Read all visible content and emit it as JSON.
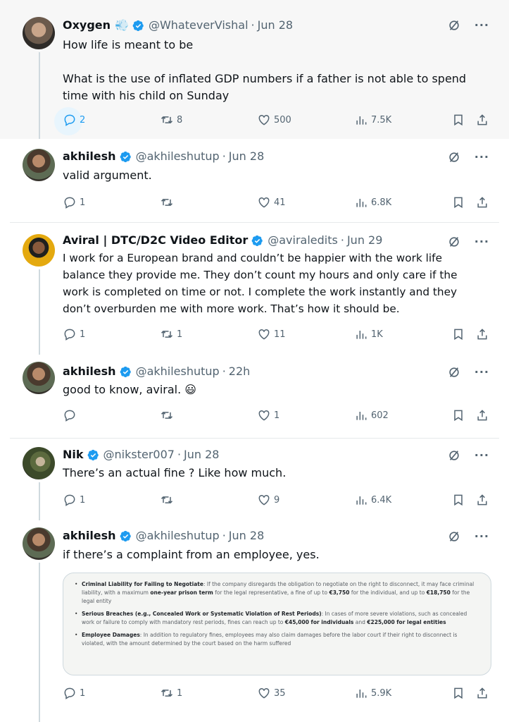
{
  "tweets": [
    {
      "name": "Oxygen",
      "emoji": "💨",
      "handle": "@WhateverVishal",
      "date": "Jun 28",
      "text_line1": "How life is meant to be",
      "text_line2": "What is the use of inflated GDP numbers if a father is not able to spend time with his child on Sunday",
      "replies": "2",
      "retweets": "8",
      "likes": "500",
      "views": "7.5K"
    },
    {
      "name": "akhilesh",
      "handle": "@akhileshutup",
      "date": "Jun 28",
      "text": "valid argument.",
      "replies": "1",
      "retweets": "",
      "likes": "41",
      "views": "6.8K"
    },
    {
      "name": "Aviral | DTC/D2C Video Editor",
      "handle": "@aviraledits",
      "date": "Jun 29",
      "text": "I work for a European brand and couldn’t be happier with the work life balance they provide me. They don’t count my hours and only care if the work is completed on time or not. I complete the work instantly and they don’t overburden me with more work. That’s how it should be.",
      "replies": "1",
      "retweets": "1",
      "likes": "11",
      "views": "1K"
    },
    {
      "name": "akhilesh",
      "handle": "@akhileshutup",
      "date": "22h",
      "text": "good to know, aviral. 😃",
      "replies": "",
      "retweets": "",
      "likes": "1",
      "views": "602"
    },
    {
      "name": "Nik",
      "handle": "@nikster007",
      "date": "Jun 28",
      "text": "There’s an actual fine ? Like how much.",
      "replies": "1",
      "retweets": "",
      "likes": "9",
      "views": "6.4K"
    },
    {
      "name": "akhilesh",
      "handle": "@akhileshutup",
      "date": "Jun 28",
      "text": "if there’s a complaint from an employee, yes.",
      "replies": "1",
      "retweets": "1",
      "likes": "35",
      "views": "5.9K"
    }
  ],
  "media": {
    "b1_title": "Criminal Liability for Failing to Negotiate",
    "b1_text_a": ": If the company disregards the obligation to negotiate on the right to disconnect, it may face criminal liability, with a maximum ",
    "b1_bold_a": "one-year prison term",
    "b1_text_b": " for the legal representative, a fine of up to ",
    "b1_bold_b": "€3,750",
    "b1_text_c": " for the individual, and up to ",
    "b1_bold_c": "€18,750",
    "b1_text_d": " for the legal entity",
    "b2_title": "Serious Breaches (e.g., Concealed Work or Systematic Violation of Rest Periods)",
    "b2_text_a": ": In cases of more severe violations, such as concealed work or failure to comply with mandatory rest periods, fines can reach up to ",
    "b2_bold_a": "€45,000 for individuals",
    "b2_text_b": " and ",
    "b2_bold_b": "€225,000 for legal entities",
    "b3_title": "Employee Damages",
    "b3_text_a": ": In addition to regulatory fines, employees may also claim damages before the labor court if their right to disconnect is violated, with the amount determined by the court based on the harm suffered"
  },
  "colors": {
    "verified": "#1d9bf0",
    "secondary_text": "#536471",
    "highlight_bg": "#f7f7f7"
  },
  "icons": [
    "verified-badge-icon",
    "grok-icon",
    "more-icon",
    "reply-icon",
    "retweet-icon",
    "like-icon",
    "views-icon",
    "bookmark-icon",
    "share-icon"
  ]
}
